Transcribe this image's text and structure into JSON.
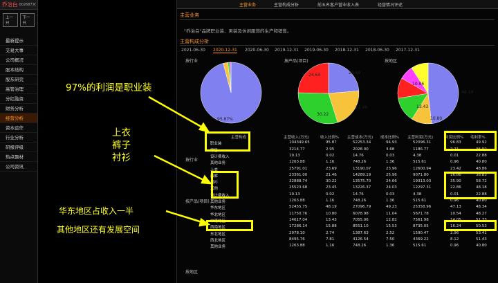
{
  "sidebar": {
    "stock_name": "乔治白",
    "stock_code": "002687",
    "close": "✕",
    "prev": "上一只",
    "next": "下一只",
    "items": [
      "最新提示",
      "交易大事",
      "公司概况",
      "股本结构",
      "股东研究",
      "高管治理",
      "分红融资",
      "财务分析",
      "经营分析",
      "资本运作",
      "行业分析",
      "研报评级",
      "热点题材",
      "公司资讯"
    ],
    "active_index": 8
  },
  "tabs": [
    "主营业务",
    "主营构成分析",
    "前五名客户营业收入表",
    "经营情况评述"
  ],
  "section1_title": "主营业务",
  "intro": "\"乔治白\"品牌职业装、男装及休闲服饰的生产和销售。",
  "section2_title": "主营构成分析",
  "years": [
    "2021-06-30",
    "2020-12-31",
    "2020-06-30",
    "2019-12-31",
    "2019-06-30",
    "2018-12-31",
    "2018-06-30",
    "2017-12-31"
  ],
  "pies": [
    {
      "title": "按行业",
      "colors": [
        "#8080f0",
        "#f7c33a",
        "#3ad03a",
        "#f050f0"
      ],
      "values": [
        95.87,
        2.5,
        1.0,
        0.63
      ],
      "labels": [
        "95.87%"
      ]
    },
    {
      "title": "按产品(项目)",
      "colors": [
        "#8080f0",
        "#f7c33a",
        "#2ed02e",
        "#ff2020"
      ],
      "values": [
        23.69,
        21.46,
        30.22,
        24.63
      ],
      "labels": [
        "23.69",
        "21.46",
        "30.22",
        "24.63"
      ]
    },
    {
      "title": "按地区",
      "colors": [
        "#8080f0",
        "#f7c33a",
        "#2ed02e",
        "#ff2020",
        "#ff40ff",
        "#ffff30"
      ],
      "values": [
        48.19,
        10.8,
        13.43,
        10.86,
        7.5,
        9.22
      ],
      "labels": [
        "48.19",
        "10.80",
        "13.43",
        "10.86"
      ]
    }
  ],
  "table": {
    "headers": [
      "主营构成",
      "主营收入(万元)",
      "收入比例%",
      "主营成本(万元)",
      "成本比例%",
      "主营利润(万元)",
      "利润比例%",
      "毛利率%"
    ],
    "groups": [
      "按行业",
      "按产品(项目)",
      "按地区"
    ],
    "rows": [
      [
        "职业装",
        "104349.65",
        "95.87",
        "52253.34",
        "94.93",
        "52096.31",
        "96.83",
        "49.92"
      ],
      [
        "零售",
        "3214.77",
        "2.95",
        "2028.00",
        "3.68",
        "1186.77",
        "2.21",
        "36.92"
      ],
      [
        "设计费收入",
        "19.13",
        "0.02",
        "14.76",
        "0.03",
        "4.38",
        "0.01",
        "22.88"
      ],
      [
        "其他业务",
        "1263.88",
        "1.16",
        "748.26",
        "1.36",
        "515.61",
        "0.96",
        "40.80"
      ],
      [
        "上衣",
        "25791.01",
        "23.69",
        "13190.07",
        "23.96",
        "12600.94",
        "23.42",
        "48.86"
      ],
      [
        "西裤",
        "23361.00",
        "21.46",
        "14289.19",
        "25.96",
        "9071.80",
        "16.86",
        "38.83"
      ],
      [
        "衬衫",
        "32888.74",
        "30.22",
        "13575.70",
        "24.66",
        "19313.03",
        "35.90",
        "58.72"
      ],
      [
        "其他",
        "25523.68",
        "23.45",
        "13226.37",
        "24.03",
        "12297.31",
        "22.86",
        "48.18"
      ],
      [
        "设计费收入",
        "19.13",
        "0.02",
        "14.76",
        "0.03",
        "4.38",
        "0.01",
        "22.88"
      ],
      [
        "其他业务",
        "1263.88",
        "1.16",
        "748.26",
        "1.36",
        "515.61",
        "0.96",
        "40.80"
      ],
      [
        "华东地区",
        "52455.75",
        "48.19",
        "27096.79",
        "49.23",
        "25358.96",
        "47.13",
        "48.34"
      ],
      [
        "华北地区",
        "11750.76",
        "10.80",
        "6078.98",
        "11.04",
        "5671.78",
        "10.54",
        "48.27"
      ],
      [
        "中南地区",
        "14617.04",
        "13.43",
        "7055.06",
        "12.82",
        "7561.98",
        "14.05",
        "51.73"
      ],
      [
        "西南地区",
        "17286.14",
        "15.88",
        "8551.10",
        "15.53",
        "8735.05",
        "16.24",
        "50.53"
      ],
      [
        "东北地区",
        "2978.10",
        "2.74",
        "1387.63",
        "2.52",
        "1590.47",
        "2.96",
        "53.41"
      ],
      [
        "西北地区",
        "8495.76",
        "7.81",
        "4126.54",
        "7.50",
        "4369.22",
        "8.12",
        "51.43"
      ],
      [
        "其他业务",
        "1263.88",
        "1.16",
        "748.26",
        "1.36",
        "515.61",
        "0.96",
        "40.80"
      ]
    ]
  },
  "annotations": {
    "a1": "97%的利润是职业装",
    "a2": "上衣",
    "a3": "裤子",
    "a4": "衬衫",
    "a5": "华东地区占收入一半",
    "a6": "其他地区还有发展空间"
  }
}
